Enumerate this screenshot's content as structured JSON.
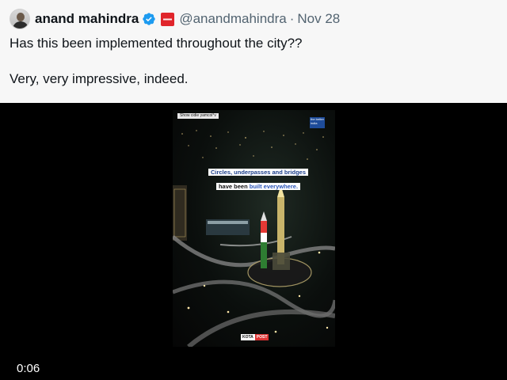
{
  "tweet": {
    "author_name": "anand mahindra",
    "handle": "@anandmahindra",
    "separator": "·",
    "date": "Nov 28",
    "text_line_1": "Has this been implemented throughout the city??",
    "text_line_2": "Very, very impressive, indeed."
  },
  "video": {
    "top_tag": "Show cidie yamcoi°v",
    "logo_text": "the better india",
    "caption_line_1": "Circles, underpasses and bridges",
    "caption_line_2_prefix": "have been ",
    "caption_line_2_highlight": "built everywhere.",
    "watermark_a": "KOTA",
    "watermark_b": "POST",
    "timestamp": "0:06"
  },
  "colors": {
    "card_background": "#f7f7f7",
    "verified_blue": "#1d9bf0",
    "badge_red": "#e0252b",
    "muted_text": "#536471"
  },
  "icons": [
    "verified-icon",
    "affiliate-badge-icon"
  ]
}
